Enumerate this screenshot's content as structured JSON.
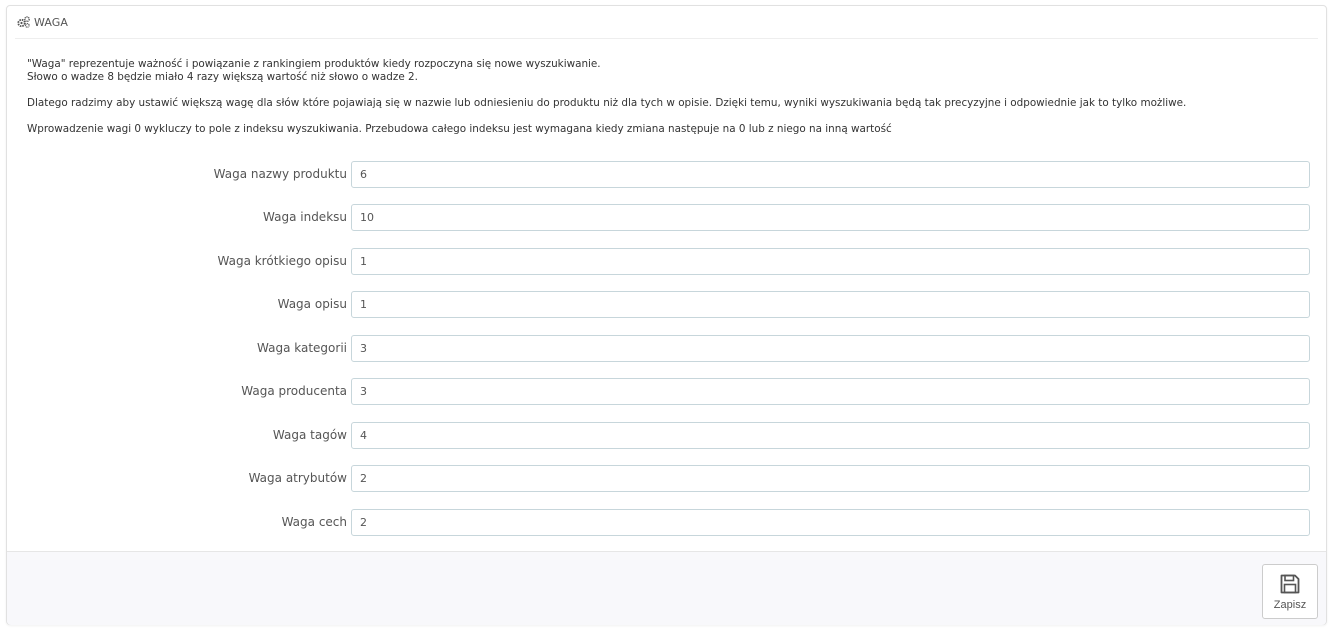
{
  "panel": {
    "title": "WAGA",
    "icon": "cogs-icon"
  },
  "intro": {
    "line1": "\"Waga\" reprezentuje ważność i powiązanie z rankingiem produktów kiedy rozpoczyna się nowe wyszukiwanie.",
    "line2": "Słowo o wadze 8 będzie miało 4 razy większą wartość niż słowo o wadze 2.",
    "line3": "Dlatego radzimy aby ustawić większą wagę dla słów które pojawiają się w nazwie lub odniesieniu do produktu niż dla tych w opisie. Dzięki temu, wyniki wyszukiwania będą tak precyzyjne i odpowiednie jak to tylko możliwe.",
    "line4": "Wprowadzenie wagi 0 wykluczy to pole z indeksu wyszukiwania. Przebudowa całego indeksu jest wymagana kiedy zmiana następuje na 0 lub z niego na inną wartość"
  },
  "fields": [
    {
      "label": "Waga nazwy produktu",
      "value": "6"
    },
    {
      "label": "Waga indeksu",
      "value": "10"
    },
    {
      "label": "Waga krótkiego opisu",
      "value": "1"
    },
    {
      "label": "Waga opisu",
      "value": "1"
    },
    {
      "label": "Waga kategorii",
      "value": "3"
    },
    {
      "label": "Waga producenta",
      "value": "3"
    },
    {
      "label": "Waga tagów",
      "value": "4"
    },
    {
      "label": "Waga atrybutów",
      "value": "2"
    },
    {
      "label": "Waga cech",
      "value": "2"
    }
  ],
  "footer": {
    "save_label": "Zapisz",
    "save_icon": "save-icon"
  }
}
